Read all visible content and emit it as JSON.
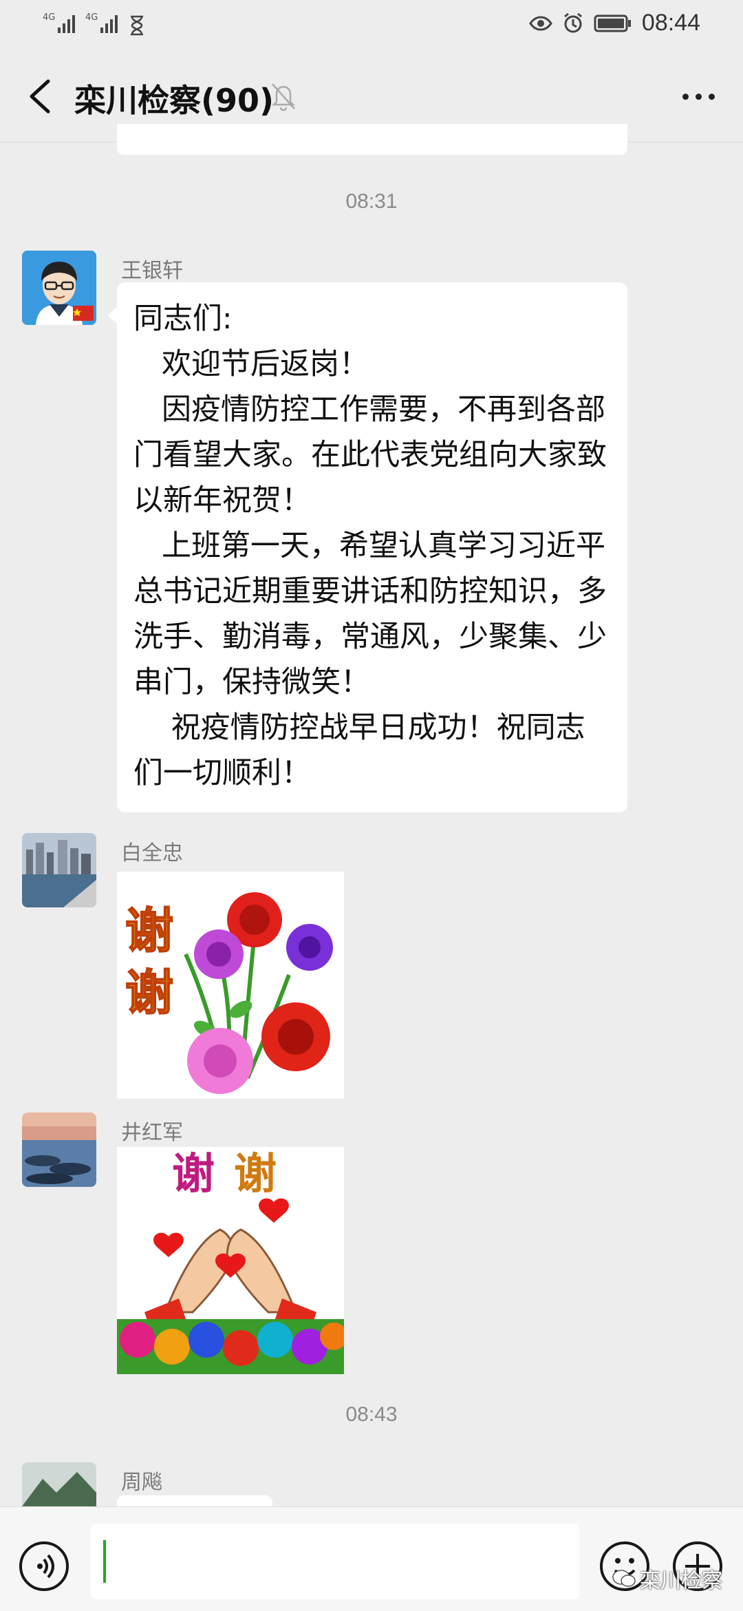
{
  "status_bar": {
    "signal1": "4G",
    "signal2": "4G",
    "time": "08:44"
  },
  "header": {
    "title": "栾川检察(90)"
  },
  "chat": {
    "timestamp1": "08:31",
    "message1": {
      "sender": "王银轩",
      "text": "同志们:\n   欢迎节后返岗！\n   因疫情防控工作需要，不再到各部门看望大家。在此代表党组向大家致以新年祝贺！\n   上班第一天，希望认真学习习近平总书记近期重要讲话和防控知识，多洗手、勤消毒，常通风，少聚集、少串门，保持微笑！\n    祝疫情防控战早日成功！祝同志们一切顺利！"
    },
    "message2": {
      "sender": "白全忠",
      "sticker_text": "谢谢"
    },
    "message3": {
      "sender": "井红军",
      "sticker_text": "谢谢"
    },
    "timestamp2": "08:43",
    "message4": {
      "sender": "周飚"
    }
  },
  "input_bar": {
    "watermark": "栾川检察"
  }
}
